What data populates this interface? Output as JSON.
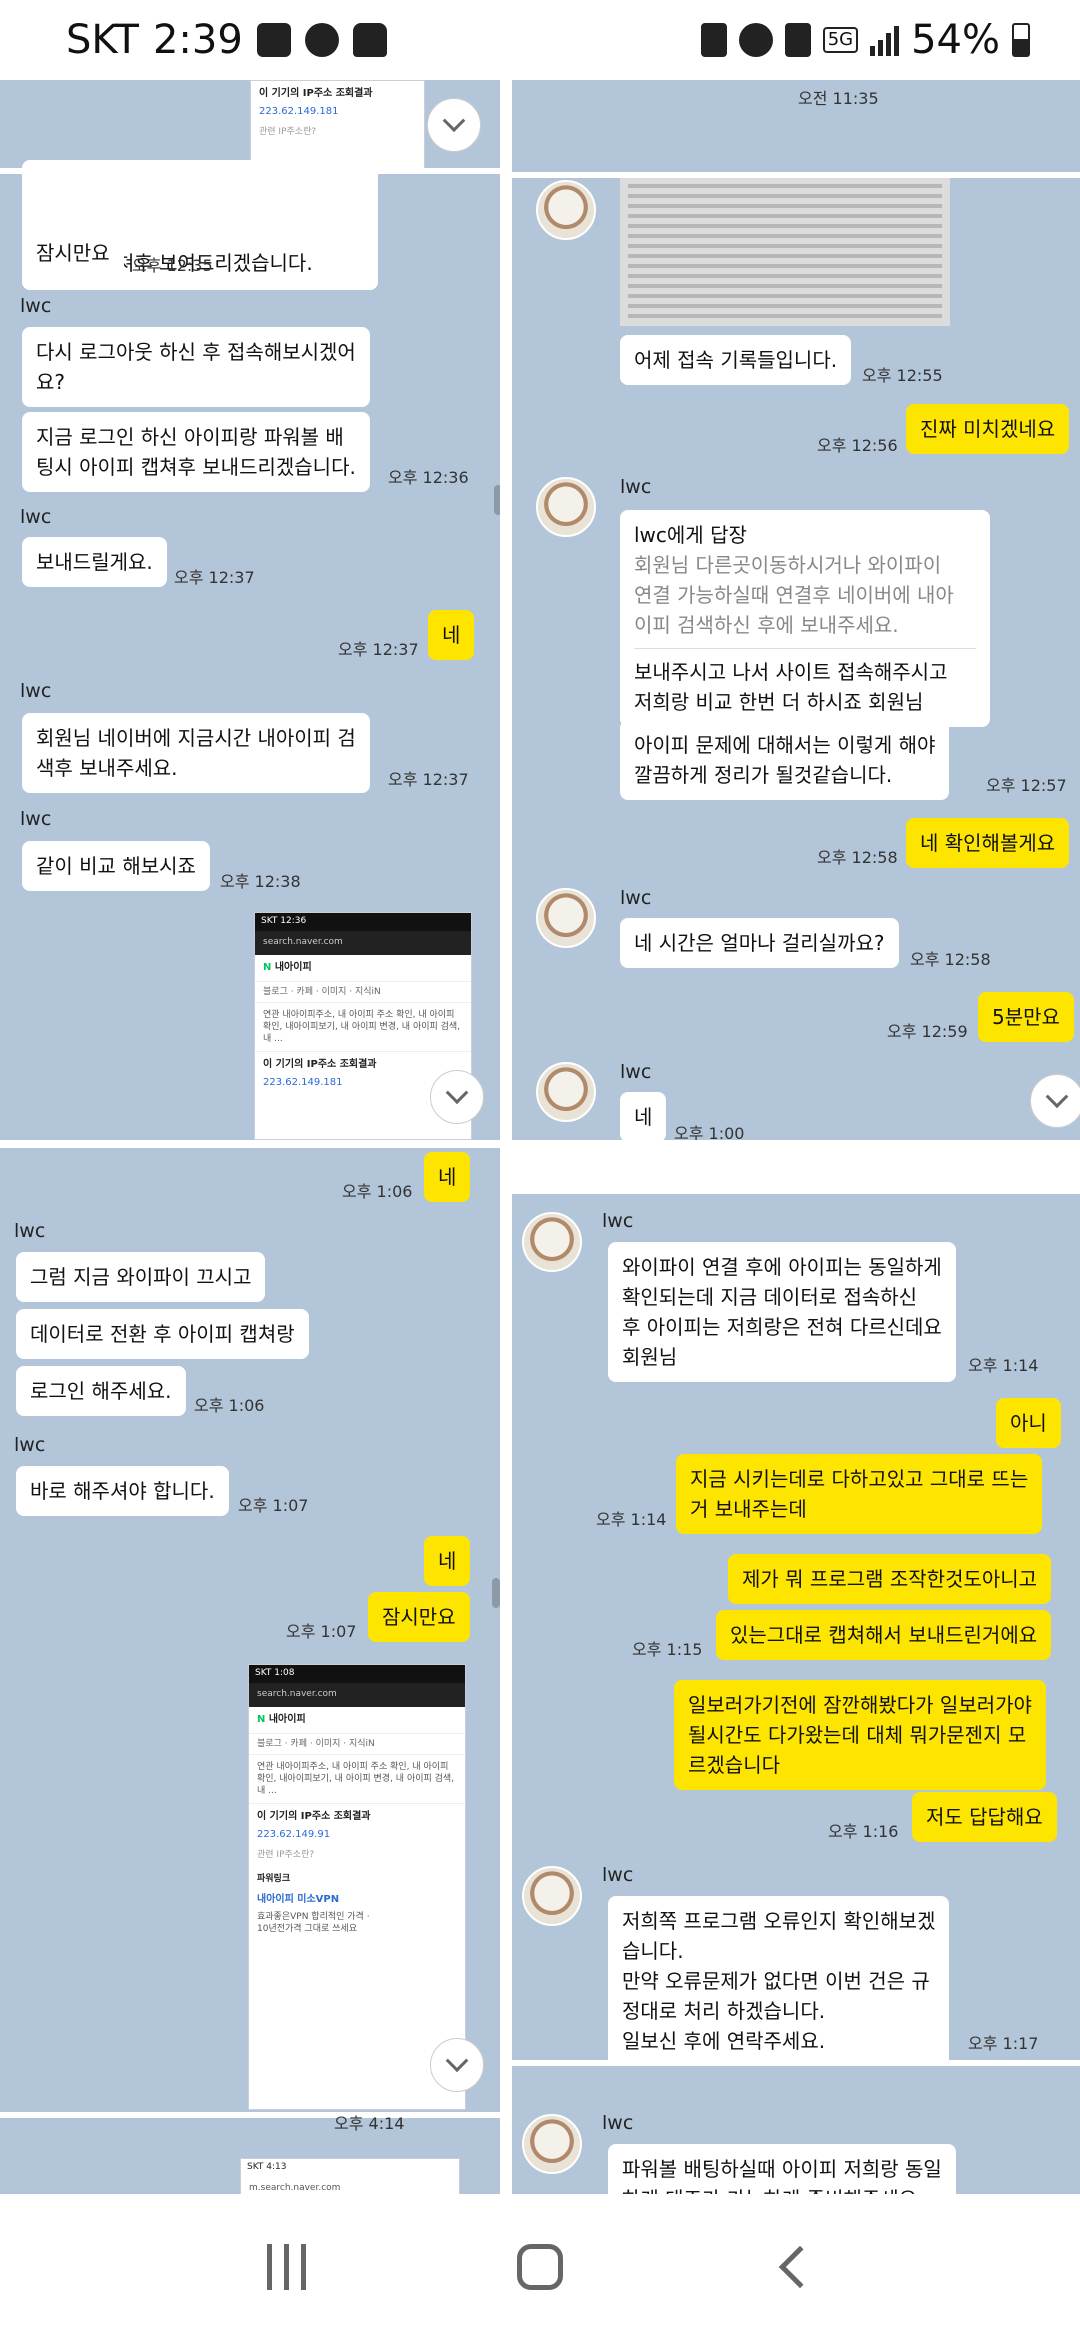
{
  "status": {
    "carrier": "SKT",
    "time": "2:39",
    "network": "5G",
    "battery": "54%"
  },
  "icons": {
    "gallery": "image-icon",
    "talk": "kakaotalk-icon",
    "lock": "lock-icon",
    "nfc": "nfc-icon",
    "alarm": "alarm-icon",
    "mute": "mute-icon",
    "signal": "signal-icon",
    "battery": "battery-icon",
    "scroll": "chevron-down-icon",
    "avatar": "watch-avatar-icon"
  },
  "colors": {
    "chat_bg": "#b3c6d9",
    "mine_bubble": "#fee500",
    "other_bubble": "#ffffff"
  },
  "sender": "lwc",
  "ip_lookup": {
    "title": "이 기기의 IP주소 조회결과",
    "ip1": "223.62.149.181",
    "ip2": "223.62.149.91",
    "link": "관련 IP주소란?"
  },
  "naver": {
    "url": "search.naver.com",
    "url2": "m.search.naver.com",
    "query": "내아이피",
    "tabs": "블로그 · 카페 · 이미지 · 지식iN",
    "related": "연관 내아이피주소, 내 아이피 주소 확인, 내 아이피 확인, 내아이피보기, 내 아이피 변경, 내 아이피 검색, 내 ...",
    "powerlink": "파워링크",
    "ad_title": "내아이피 미소VPN",
    "ad_desc": "효과좋은VPN 합리적인 가격 · 10년전가격 그대로 쓰세요",
    "status1": "SKT 12:36",
    "status2": "SKT 1:08",
    "status3": "SKT 4:13"
  },
  "p1": {
    "partial": "아이피 캡쳐후 보여드리겠습니다.",
    "m1": "잠시만요",
    "t1": "오후 12:35",
    "m2": "다시 로그아웃 하신 후 접속해보시겠어\n요?",
    "m3": "지금 로그인 하신 아이피랑 파워볼 배\n팅시 아이피 캡쳐후 보내드리겠습니다.",
    "t3": "오후 12:36",
    "m4": "보내드릴게요.",
    "t4": "오후 12:37",
    "y1": "네",
    "ty1": "오후 12:37",
    "m5": "회원님 네이버에 지금시간 내아이피 검\n색후 보내주세요.",
    "t5": "오후 12:37",
    "m6": "같이 비교 해보시죠",
    "t6": "오후 12:38"
  },
  "p2": {
    "top_time": "오전 11:35",
    "m1": "어제 접속 기록들입니다.",
    "t1": "오후 12:55",
    "y1": "진짜 미치겠네요",
    "ty1": "오후 12:56",
    "reply_head": "lwc에게 답장",
    "reply_quote": "회원님 다른곳이동하시거나 와이파이\n연결 가능하실때 연결후 네이버에 내아\n이피 검색하신 후에 보내주세요.",
    "reply_body": "보내주시고 나서 사이트 접속해주시고\n저희랑 비교 한번 더 하시죠 회원님",
    "m2": "아이피 문제에 대해서는 이렇게 해야\n깔끔하게 정리가 될것같습니다.",
    "t2": "오후 12:57",
    "y2": "네 확인해볼게요",
    "ty2": "오후 12:58",
    "m3": "네 시간은 얼마나 걸리실까요?",
    "t3": "오후 12:58",
    "y3": "5분만요",
    "ty3": "오후 12:59",
    "m4": "네",
    "t4": "오후 1:00"
  },
  "p3": {
    "y1": "네",
    "ty1": "오후 1:06",
    "m1": "그럼 지금 와이파이 끄시고",
    "m2": "데이터로 전환 후 아이피 캡쳐랑",
    "m3": "로그인 해주세요.",
    "t3": "오후 1:06",
    "m4": "바로 해주셔야 합니다.",
    "t4": "오후 1:07",
    "y2": "네",
    "y3": "잠시만요",
    "ty3": "오후 1:07",
    "t_bottom": "오후 4:14"
  },
  "p4": {
    "m1": "와이파이 연결 후에 아이피는 동일하게\n확인되는데 지금 데이터로 접속하신\n후 아이피는 저희랑은 전혀 다르신데요\n회원님",
    "t1": "오후 1:14",
    "y1": "아니",
    "y2": "지금 시키는데로 다하고있고 그대로 뜨는\n거 보내주는데",
    "ty2": "오후 1:14",
    "y3": "제가 뭐 프로그램 조작한것도아니고",
    "y4": "있는그대로 캡쳐해서 보내드린거에요",
    "ty4": "오후 1:15",
    "y5": "일보러가기전에 잠깐해봤다가 일보러가야\n될시간도 다가왔는데 대체 뭐가문젠지 모\n르겠습니다",
    "y6": "저도 답답해요",
    "ty6": "오후 1:16",
    "m2": "저희쪽 프로그램 오류인지 확인해보겠\n습니다.\n만약 오류문제가 없다면 이번 건은 규\n정대로 처리 하겠습니다.\n일보신 후에 연락주세요.",
    "t2": "오후 1:17",
    "m3": "파워볼 배팅하실때 아이피 저희랑 동일\n하게 대조가 가능하게 준비해주세요."
  }
}
